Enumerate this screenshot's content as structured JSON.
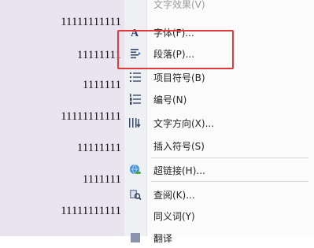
{
  "document": {
    "lines": [
      {
        "text": "11111111111"
      },
      {
        "text": "11111111"
      },
      {
        "text": "1111111"
      },
      {
        "text": "11111111111"
      },
      {
        "text": "11111111"
      },
      {
        "text": "1111111"
      },
      {
        "text": "11111111111"
      }
    ]
  },
  "menu": {
    "items": [
      {
        "label": "文字效果(V)",
        "icon": "text-effect-icon"
      },
      {
        "label": "字体(F)...",
        "icon": "font-icon"
      },
      {
        "label": "段落(P)...",
        "icon": "paragraph-icon"
      },
      {
        "label": "项目符号(B)",
        "icon": "bullets-icon"
      },
      {
        "label": "编号(N)",
        "icon": "numbering-icon"
      },
      {
        "label": "文字方向(X)...",
        "icon": "text-direction-icon"
      },
      {
        "label": "插入符号(S)",
        "icon": ""
      },
      {
        "label": "超链接(H)...",
        "icon": "hyperlink-icon"
      },
      {
        "label": "查阅(K)...",
        "icon": "lookup-icon"
      },
      {
        "label": "同义词(Y)",
        "icon": ""
      },
      {
        "label": "翻译",
        "icon": "translate-icon"
      }
    ]
  },
  "colors": {
    "highlight": "#e23a3a",
    "document_bg": "#e9e4ef"
  }
}
